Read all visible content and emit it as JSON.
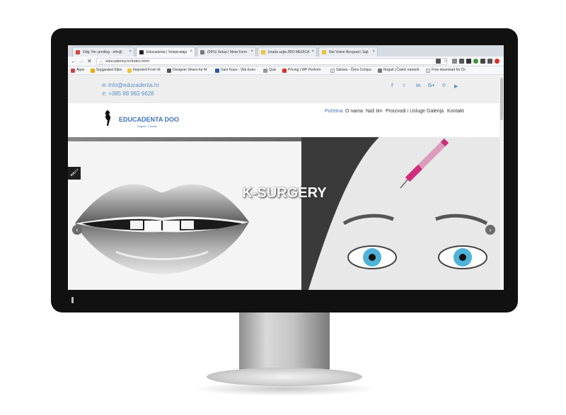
{
  "browser": {
    "tabs": [
      {
        "title": "Odg: Re: predlog - info@",
        "active": false,
        "favicon_color": "#d44638"
      },
      {
        "title": "Educadenta | Veleprodaja",
        "active": true,
        "favicon_color": "#222222"
      },
      {
        "title": "(56%) Setup | Meta Form",
        "active": false,
        "favicon_color": "#777777"
      },
      {
        "title": "Izrada sajta ZBO MEDICA",
        "active": false,
        "favicon_color": "#f1c232"
      },
      {
        "title": "Net Vision Beograd | Sajt",
        "active": false,
        "favicon_color": "#f1c232"
      }
    ],
    "url": "educadenta.hr/index.html",
    "bookmarks": [
      "Apps",
      "Suggested Sites",
      "Imported From IE",
      "Designer Shoes for M",
      "Sani Tours - Vila Even",
      "Quix",
      "Pricing | WP Perform",
      "Sahara - Čimo Compa",
      "Regali | Čarkić namešt",
      "Free download for Ch"
    ]
  },
  "site": {
    "email": "info@educadenta.hr",
    "phone": "+385 98 983 6628",
    "brand_name": "EDUCADENTA DOO",
    "brand_location": "Zagreb, Croatia",
    "menu": [
      "Početna",
      "O nama",
      "Naš tim",
      "Proizvodi i Usluge",
      "Galerija",
      "Kontakt"
    ],
    "social_icons": [
      "facebook-icon",
      "twitter-icon",
      "linkedin-icon",
      "google-plus-icon",
      "pinterest-icon",
      "youtube-icon"
    ],
    "hero_title": "K-SURGERY"
  },
  "colors": {
    "accent": "#3b73b5",
    "top_bar": "#eeeeee",
    "bezel": "#111111"
  }
}
